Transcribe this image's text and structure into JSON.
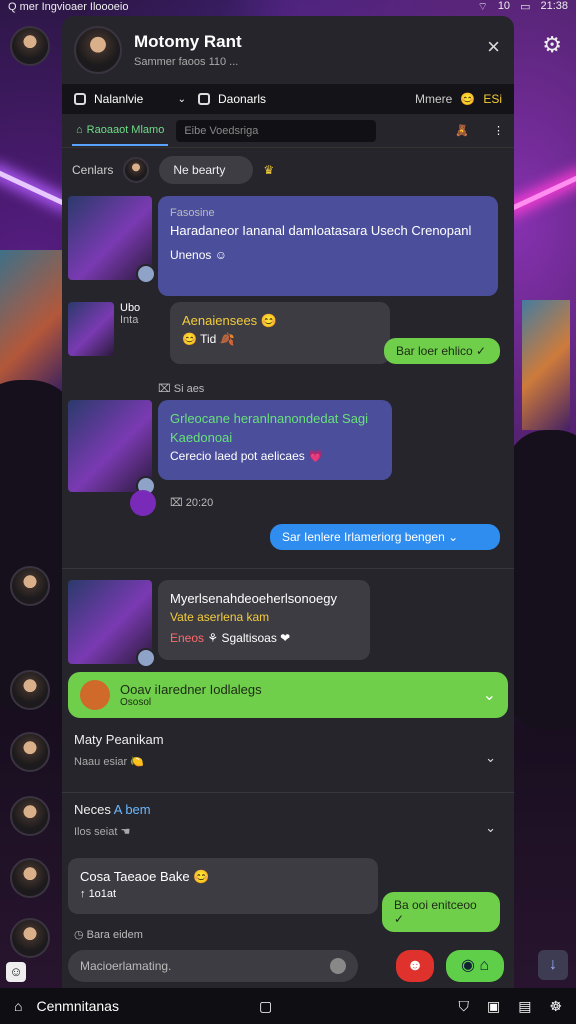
{
  "status": {
    "left": "Q  mer Ingvioaer Iloooeio",
    "right": "10",
    "battery": "21:38"
  },
  "header": {
    "title": "Motomy Rant",
    "subtitle": "Sammer faoos  110  ...",
    "close": "×"
  },
  "toolbar": {
    "dropdown": "Nalanlvie",
    "menu": "Daonarls",
    "right_label": "Mmere",
    "right_tag": "ESi"
  },
  "tabs": {
    "active": "Raoaaot Mlamo",
    "search_placeholder": "Eibe Voedsriga"
  },
  "filter": {
    "label": "Cenlars",
    "pill": "Ne bearty"
  },
  "messages": [
    {
      "small": "Fasosine",
      "text": "Haradaneor Iananal damloatasara Usech Crenopanl",
      "footer": "Unenos"
    },
    {
      "side_label": "Ubo",
      "side_sub": "Inta",
      "text": "Aenaiensees",
      "sub": "Tid"
    },
    {
      "small": "Si aes",
      "text": "Grleocane heranlnanondedat Sagi Kaedonoai",
      "text2": "Cerecio laed pot aelicaes"
    },
    {
      "time": "20:20"
    },
    {
      "text": "Myerlsenahdeoeherlsonoegy",
      "text2": "Vate aserlena kam",
      "footer": "Eneos",
      "footer2": "Sgaltisoas"
    }
  ],
  "replies": [
    "Bar loer ehlico",
    "Sar Ienlere Irlameriorg bengen"
  ],
  "green_row": {
    "title": "Ooav iIaredner Iodlalegs",
    "sub": "Ososol"
  },
  "rows": [
    {
      "name": "Maty Peanikam",
      "meta": "Naau esiar"
    },
    {
      "name": "Neces",
      "highlight": "A bem",
      "meta": "Ilos seiat"
    }
  ],
  "last_msg": {
    "text": "Cosa Taeaoe Bake",
    "sub": "1o1at",
    "reply": "Ba ooi enitceoo",
    "time": "Bara eidem"
  },
  "input": {
    "placeholder": "Macioerlamating."
  },
  "nav": {
    "label": "Cenmnitanas"
  }
}
